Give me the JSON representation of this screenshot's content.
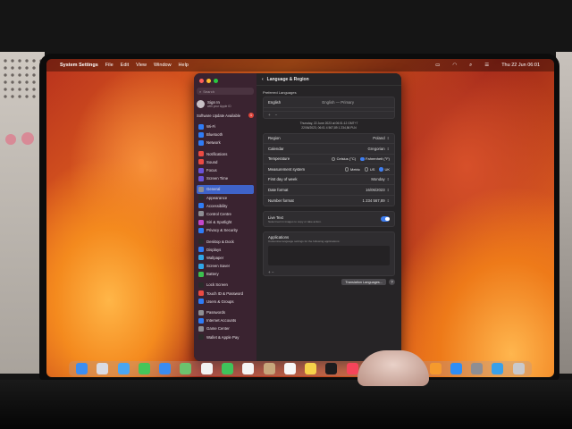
{
  "menubar": {
    "app": "System Settings",
    "items": [
      "File",
      "Edit",
      "View",
      "Window",
      "Help"
    ],
    "clock": "Thu 22 Jun 06:01"
  },
  "sidebar": {
    "search_placeholder": "Search",
    "signin_title": "Sign In",
    "signin_sub": "with your Apple ID",
    "software_update": "Software Update Available",
    "software_update_count": "1",
    "groups": [
      [
        {
          "label": "Wi-Fi",
          "color": "#2f7cf6"
        },
        {
          "label": "Bluetooth",
          "color": "#2f7cf6"
        },
        {
          "label": "Network",
          "color": "#2f7cf6"
        }
      ],
      [
        {
          "label": "Notifications",
          "color": "#ea4a43"
        },
        {
          "label": "Sound",
          "color": "#ea4a43"
        },
        {
          "label": "Focus",
          "color": "#6a53d8"
        },
        {
          "label": "Screen Time",
          "color": "#6a53d8"
        }
      ],
      [
        {
          "label": "General",
          "color": "#8e8e93",
          "active": true
        },
        {
          "label": "Appearance",
          "color": "#2b2b2b"
        },
        {
          "label": "Accessibility",
          "color": "#2f7cf6"
        },
        {
          "label": "Control Centre",
          "color": "#8e8e93"
        },
        {
          "label": "Siri & Spotlight",
          "color": "#c447c9"
        },
        {
          "label": "Privacy & Security",
          "color": "#2f7cf6"
        }
      ],
      [
        {
          "label": "Desktop & Dock",
          "color": "#2b2b2b"
        },
        {
          "label": "Displays",
          "color": "#2f7cf6"
        },
        {
          "label": "Wallpaper",
          "color": "#2fa6e8"
        },
        {
          "label": "Screen Saver",
          "color": "#2fa6e8"
        },
        {
          "label": "Battery",
          "color": "#3cbf4e"
        }
      ],
      [
        {
          "label": "Lock Screen",
          "color": "#2b2b2b"
        },
        {
          "label": "Touch ID & Password",
          "color": "#ea4a43"
        },
        {
          "label": "Users & Groups",
          "color": "#2f7cf6"
        }
      ],
      [
        {
          "label": "Passwords",
          "color": "#8e8e93"
        },
        {
          "label": "Internet Accounts",
          "color": "#2f7cf6"
        },
        {
          "label": "Game Center",
          "color": "#8e8e93"
        },
        {
          "label": "Wallet & Apple Pay",
          "color": "#2b2b2b"
        }
      ]
    ]
  },
  "content": {
    "title": "Language & Region",
    "preferred_languages_label": "Preferred Languages",
    "language": "English",
    "language_note": "English — Primary",
    "preview_line1": "Thursday, 22 June 2023 at 06:01:12 GMT+7",
    "preview_line2": "22/06/2023, 06:01   4 567,89   1 234,56 PLN",
    "region_label": "Region",
    "region_value": "Poland",
    "calendar_label": "Calendar",
    "calendar_value": "Gregorian",
    "temperature_label": "Temperature",
    "temp_options": [
      {
        "label": "Celsius (°C)",
        "selected": false
      },
      {
        "label": "Fahrenheit (°F)",
        "selected": true
      }
    ],
    "measurement_label": "Measurement system",
    "measure_options": [
      {
        "label": "Metric",
        "selected": false
      },
      {
        "label": "US",
        "selected": false
      },
      {
        "label": "UK",
        "selected": true
      }
    ],
    "first_day_label": "First day of week",
    "first_day_value": "Monday",
    "date_format_label": "Date format",
    "date_format_value": "16/06/2023",
    "number_format_label": "Number format",
    "number_format_value": "1 234 567,89",
    "live_text_title": "Live Text",
    "live_text_sub": "Select text in images to copy or take action.",
    "apps_title": "Applications",
    "apps_sub": "Customise language settings for the following applications:",
    "translation_button": "Translation Languages...",
    "help": "?"
  },
  "dock": {
    "icons": [
      {
        "name": "finder-icon",
        "color": "#3d8ef0"
      },
      {
        "name": "launchpad-icon",
        "color": "#d9dbe3"
      },
      {
        "name": "safari-icon",
        "color": "#4aa6f2"
      },
      {
        "name": "messages-icon",
        "color": "#45c55a"
      },
      {
        "name": "mail-icon",
        "color": "#3b8cf0"
      },
      {
        "name": "maps-icon",
        "color": "#6cc26e"
      },
      {
        "name": "photos-icon",
        "color": "#f2f2f2"
      },
      {
        "name": "facetime-icon",
        "color": "#3fc35b"
      },
      {
        "name": "calendar-icon",
        "color": "#f4f4f4"
      },
      {
        "name": "contacts-icon",
        "color": "#c7a77c"
      },
      {
        "name": "reminders-icon",
        "color": "#f7f7f7"
      },
      {
        "name": "notes-icon",
        "color": "#f6d24a"
      },
      {
        "name": "tv-icon",
        "color": "#1c1c1e"
      },
      {
        "name": "music-icon",
        "color": "#f5445a"
      },
      {
        "name": "podcasts-icon",
        "color": "#9c50e0"
      },
      {
        "name": "news-icon",
        "color": "#f3495a"
      },
      {
        "name": "keynote-icon",
        "color": "#2f7cf6"
      },
      {
        "name": "pages-icon",
        "color": "#f59a2d"
      },
      {
        "name": "app-store-icon",
        "color": "#2f8ef5"
      },
      {
        "name": "system-settings-icon",
        "color": "#8e8e93"
      },
      {
        "name": "downloads-folder-icon",
        "color": "#3aa0e8"
      },
      {
        "name": "trash-icon",
        "color": "#c9c9cc"
      }
    ]
  }
}
